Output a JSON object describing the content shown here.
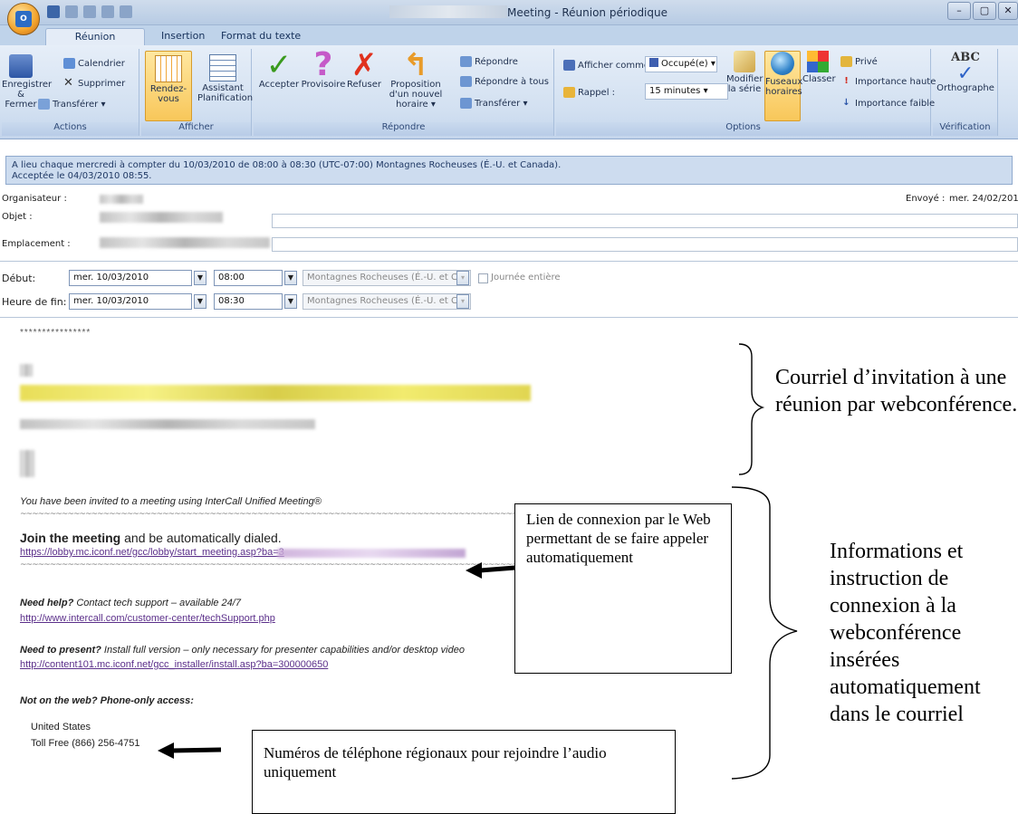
{
  "window": {
    "title": "Meeting - Réunion périodique",
    "quick_access_icons": [
      "save-icon",
      "undo-icon",
      "redo-icon",
      "up-arrow-icon",
      "down-arrow-icon"
    ],
    "controls": [
      "minimize-icon",
      "maximize-icon",
      "close-icon"
    ]
  },
  "tabs": [
    {
      "label": "Réunion périodique",
      "active": true
    },
    {
      "label": "Insertion",
      "active": false
    },
    {
      "label": "Format du texte",
      "active": false
    }
  ],
  "ribbon": {
    "actions": {
      "group": "Actions",
      "save_close": "Enregistrer & Fermer",
      "calendar": "Calendrier",
      "delete": "Supprimer",
      "forward": "Transférer"
    },
    "show": {
      "group": "Afficher",
      "appointment": "Rendez-vous",
      "scheduling": "Assistant Planification"
    },
    "respond": {
      "group": "Répondre",
      "accept": "Accepter",
      "tentative": "Provisoire",
      "decline": "Refuser",
      "propose": "Proposition d'un nouvel horaire",
      "reply": "Répondre",
      "reply_all": "Répondre à tous",
      "forward": "Transférer"
    },
    "options": {
      "group": "Options",
      "show_as_label": "Afficher comme :",
      "show_as_value": "Occupé(e)",
      "reminder_label": "Rappel :",
      "reminder_value": "15 minutes",
      "modify_series": "Modifier la série",
      "time_zones": "Fuseaux horaires",
      "categorize": "Classer",
      "private": "Privé",
      "high_importance": "Importance haute",
      "low_importance": "Importance faible"
    },
    "proofing": {
      "group": "Vérification",
      "spelling": "Orthographe",
      "spelling_icon_text": "ABC"
    }
  },
  "infobar": {
    "line1": "A lieu chaque mercredi à compter du 10/03/2010 de 08:00 à 08:30 (UTC-07:00) Montagnes Rocheuses (É.-U. et Canada).",
    "line2": "Acceptée le 04/03/2010 08:55."
  },
  "header": {
    "organizer_label": "Organisateur :",
    "subject_label": "Objet :",
    "location_label": "Emplacement :",
    "sent_label": "Envoyé :",
    "sent_value": "mer. 24/02/2010 14"
  },
  "schedule": {
    "start_label": "Début:",
    "start_date": "mer. 10/03/2010",
    "start_time": "08:00",
    "end_label": "Heure de fin:",
    "end_date": "mer. 10/03/2010",
    "end_time": "08:30",
    "timezone": "Montagnes Rocheuses (É.-U. et Can",
    "all_day": "Journée entière"
  },
  "email": {
    "stars": "****************",
    "invited": "You have been invited to a meeting using InterCall Unified Meeting®",
    "join_bold": "Join the meeting",
    "join_rest": " and be automatically dialed.",
    "join_link": "https://lobby.mc.iconf.net/gcc/lobby/start_meeting.asp?ba=3",
    "help_bold": "Need help?",
    "help_rest": " Contact tech support – available 24/7",
    "help_link": "http://www.intercall.com/customer-center/techSupport.php",
    "present_bold": "Need to present?",
    "present_rest": " Install full version – only necessary for presenter capabilities and/or desktop video",
    "present_link": "http://content101.mc.iconf.net/gcc_installer/install.asp?ba=300000650",
    "phone_heading": "Not on the web?  Phone-only access:",
    "country": "United States",
    "tollfree": "Toll Free (866) 256-4751"
  },
  "annotations": {
    "invitation": "Courriel d’invitation à une réunion par webconférence.",
    "info": "Informations et instruction de connexion à la webconférence insérées automatiquement dans le courriel",
    "link_callout": "Lien de connexion par le Web permettant de se faire appeler automatiquement",
    "phone_callout": "Numéros de téléphone régionaux pour rejoindre l’audio uniquement"
  }
}
